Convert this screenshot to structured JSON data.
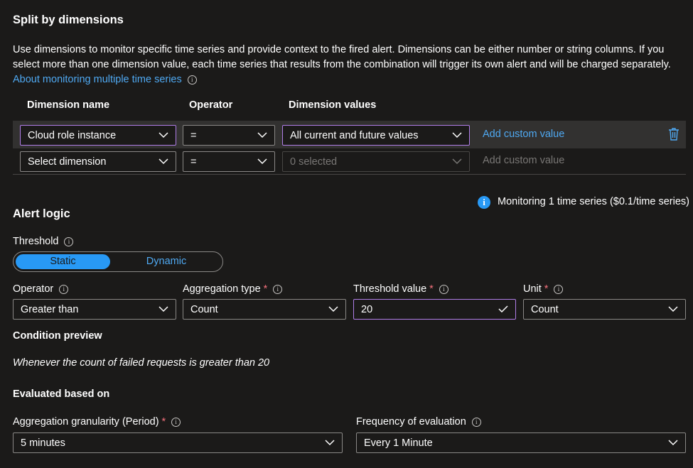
{
  "split": {
    "title": "Split by dimensions",
    "description": "Use dimensions to monitor specific time series and provide context to the fired alert. Dimensions can be either number or string columns. If you select more than one dimension value, each time series that results from the combination will trigger its own alert and will be charged separately.",
    "about_link": "About monitoring multiple time series",
    "headers": {
      "name": "Dimension name",
      "operator": "Operator",
      "values": "Dimension values"
    },
    "rows": [
      {
        "name": "Cloud role instance",
        "operator": "=",
        "values": "All current and future values",
        "custom": "Add custom value"
      },
      {
        "name": "Select dimension",
        "operator": "=",
        "values": "0 selected",
        "custom": "Add custom value"
      }
    ],
    "monitoring": "Monitoring 1 time series ($0.1/time series)"
  },
  "alert": {
    "title": "Alert logic",
    "threshold_label": "Threshold",
    "threshold_options": [
      "Static",
      "Dynamic"
    ],
    "threshold_selected": "Static",
    "operator_label": "Operator",
    "operator_value": "Greater than",
    "aggregation_label": "Aggregation type",
    "aggregation_value": "Count",
    "threshold_value_label": "Threshold value",
    "threshold_value": "20",
    "unit_label": "Unit",
    "unit_value": "Count",
    "preview_title": "Condition preview",
    "preview_text": "Whenever the count of failed requests is greater than 20"
  },
  "evaluated": {
    "title": "Evaluated based on",
    "granularity_label": "Aggregation granularity (Period)",
    "granularity_value": "5 minutes",
    "frequency_label": "Frequency of evaluation",
    "frequency_value": "Every 1 Minute"
  },
  "colors": {
    "background": "#1b1a19",
    "accent": "#2899f5",
    "link": "#4fa9f2",
    "focus_border": "#b07ee8",
    "required": "#f1707b"
  }
}
